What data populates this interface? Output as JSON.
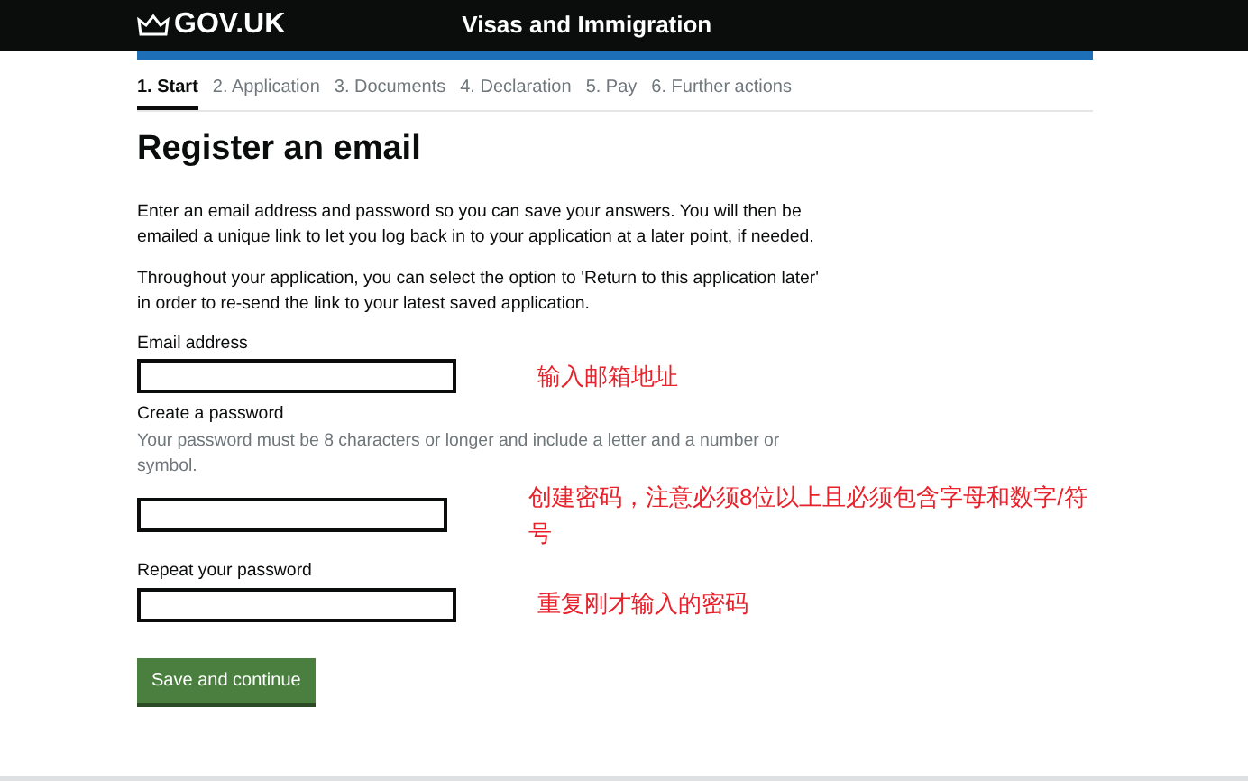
{
  "header": {
    "logo": "GOV.UK",
    "service": "Visas and Immigration"
  },
  "steps": [
    {
      "label": "1. Start",
      "selected": true
    },
    {
      "label": "2. Application",
      "selected": false
    },
    {
      "label": "3. Documents",
      "selected": false
    },
    {
      "label": "4. Declaration",
      "selected": false
    },
    {
      "label": "5. Pay",
      "selected": false
    },
    {
      "label": "6. Further actions",
      "selected": false
    }
  ],
  "title": "Register an email",
  "paragraphs": [
    "Enter an email address and password so you can save your answers. You will then be emailed a unique link to let you log back in to your application at a later point, if needed.",
    "Throughout your application, you can select the option to 'Return to this application later' in order to re-send the link to your latest saved application."
  ],
  "fields": [
    {
      "label": "Email address",
      "annotation": "输入邮箱地址"
    },
    {
      "label": "Create a password",
      "hint": "Your password must be 8 characters or longer and include a letter and a number or symbol.",
      "annotation": "创建密码，注意必须8位以上且必须包含字母和数字/符号"
    },
    {
      "label": "Repeat your password",
      "annotation": "重复刚才输入的密码"
    }
  ],
  "button": "Save and continue"
}
